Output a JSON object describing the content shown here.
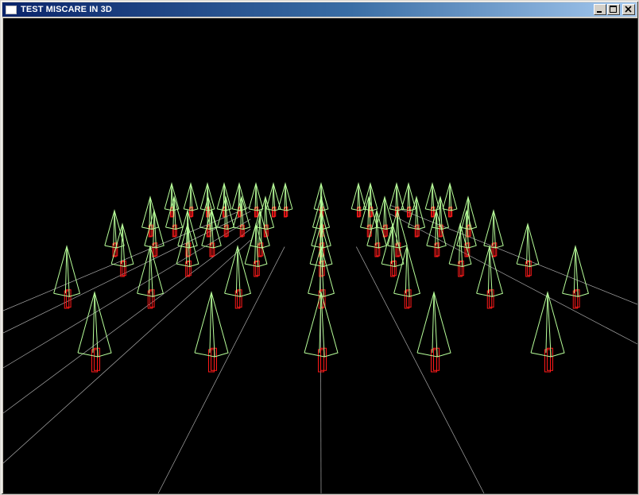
{
  "window": {
    "title": "TEST MISCARE IN 3D",
    "minimize_icon": "minimize-icon",
    "maximize_icon": "maximize-icon",
    "close_icon": "close-icon"
  },
  "scene": {
    "background": "#000000",
    "ground_line_color": "#c8c8c8",
    "cone_color": "#b8ff9a",
    "trunk_color": "#ff1a1a"
  }
}
